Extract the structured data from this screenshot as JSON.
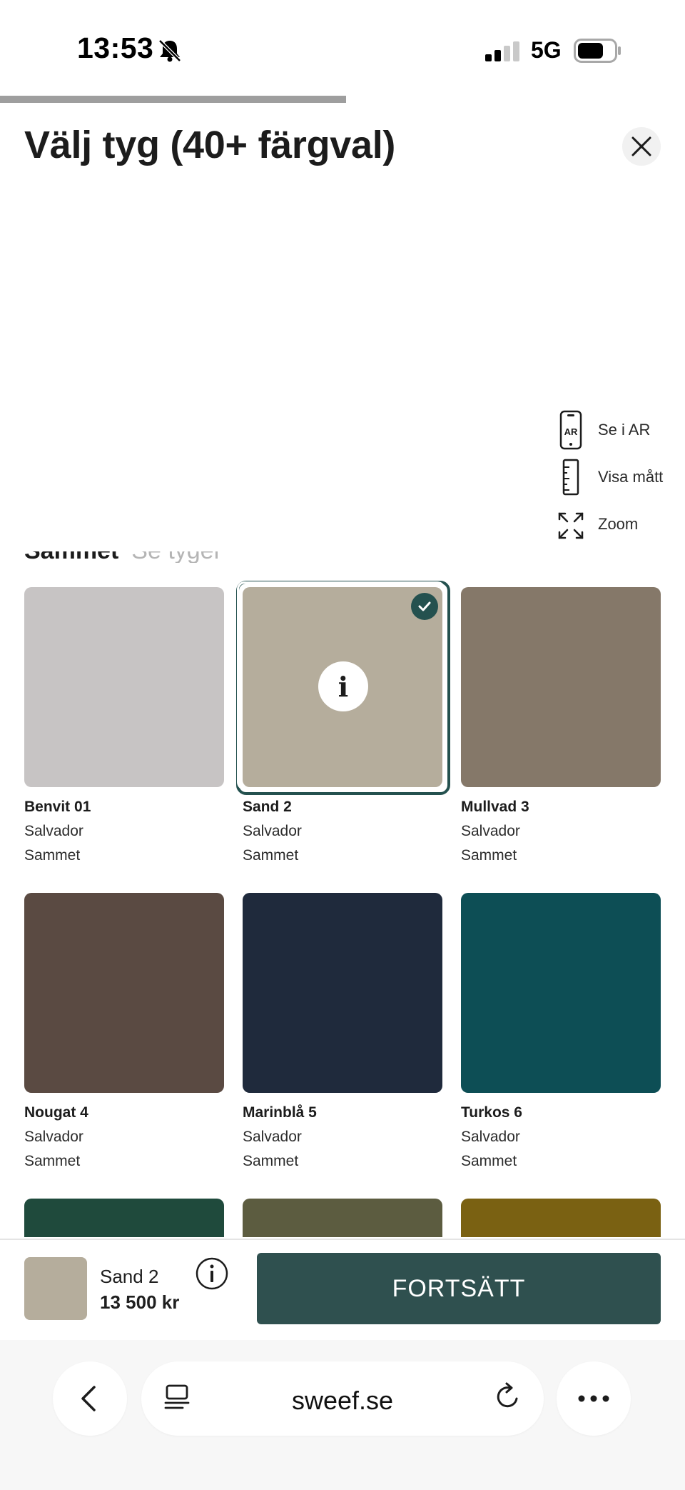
{
  "status_bar": {
    "time": "13:53",
    "network": "5G",
    "silent_icon": "bell-slash-icon",
    "signal_bars_active": 2,
    "signal_bars_total": 4,
    "battery_level": 0.7
  },
  "progress": {
    "fraction": 0.505
  },
  "header": {
    "title": "Välj tyg (40+ färgval)",
    "close_icon": "close-icon"
  },
  "tools": [
    {
      "label": "Se i AR",
      "icon": "ar-phone-icon"
    },
    {
      "label": "Visa mått",
      "icon": "ruler-icon"
    },
    {
      "label": "Zoom",
      "icon": "expand-icon"
    }
  ],
  "section": {
    "name": "Sammet",
    "link": "Se tyger"
  },
  "swatches": [
    {
      "name": "Benvit 01",
      "line1": "Salvador",
      "line2": "Sammet",
      "color": "#c7c4c4",
      "selected": false
    },
    {
      "name": "Sand 2",
      "line1": "Salvador",
      "line2": "Sammet",
      "color": "#b5ad9c",
      "selected": true
    },
    {
      "name": "Mullvad 3",
      "line1": "Salvador",
      "line2": "Sammet",
      "color": "#857869",
      "selected": false
    },
    {
      "name": "Nougat 4",
      "line1": "Salvador",
      "line2": "Sammet",
      "color": "#5a4a42",
      "selected": false
    },
    {
      "name": "Marinblå 5",
      "line1": "Salvador",
      "line2": "Sammet",
      "color": "#1f2a3c",
      "selected": false
    },
    {
      "name": "Turkos 6",
      "line1": "Salvador",
      "line2": "Sammet",
      "color": "#0d4e55",
      "selected": false
    },
    {
      "name": "",
      "line1": "",
      "line2": "",
      "color": "#1f4a3c",
      "selected": false
    },
    {
      "name": "",
      "line1": "",
      "line2": "",
      "color": "#5c5c40",
      "selected": false
    },
    {
      "name": "",
      "line1": "",
      "line2": "",
      "color": "#7a6112",
      "selected": false
    }
  ],
  "selection": {
    "name": "Sand 2",
    "price": "13 500 kr",
    "color": "#b5ad9c"
  },
  "cta": {
    "label": "FORTSÄTT"
  },
  "browser": {
    "url": "sweef.se"
  },
  "colors": {
    "accent": "#24514f",
    "cta": "#2f504f"
  }
}
